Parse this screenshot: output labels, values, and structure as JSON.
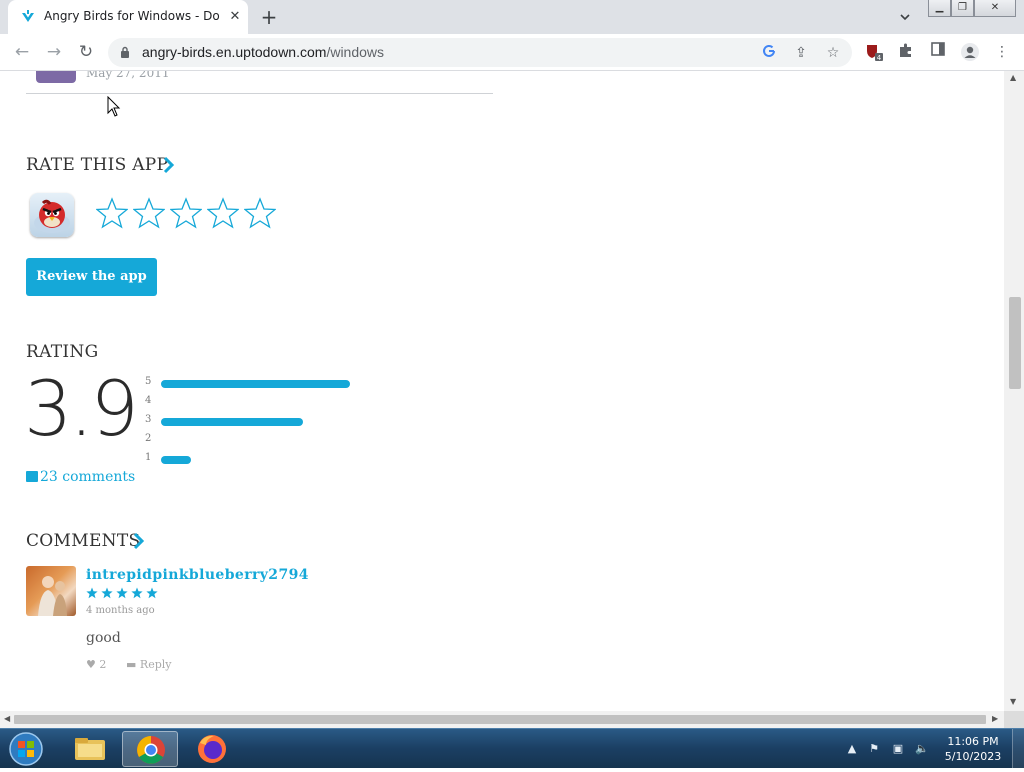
{
  "browser": {
    "tab_title": "Angry Birds for Windows - Down",
    "url_host": "angry-birds.en.uptodown.com",
    "url_path": "/windows",
    "extension_badge": "4"
  },
  "page": {
    "previous_comment_date": "May 27, 2011",
    "rate_section_title": "RATE THIS APP",
    "review_button_label": "Review the app",
    "rating_section_title": "RATING",
    "rating_score": "3.9",
    "rating_bars": [
      {
        "stars": "5",
        "fraction": 1.0
      },
      {
        "stars": "4",
        "fraction": 0.0
      },
      {
        "stars": "3",
        "fraction": 0.75
      },
      {
        "stars": "2",
        "fraction": 0.0
      },
      {
        "stars": "1",
        "fraction": 0.16
      }
    ],
    "comments_link": "23 comments",
    "comments_section_title": "COMMENTS",
    "comment": {
      "username": "intrepidpinkblueberry2794",
      "stars": 5,
      "time_ago": "4 months ago",
      "text": "good",
      "likes": "2",
      "reply_label": "Reply"
    }
  },
  "taskbar": {
    "time": "11:06 PM",
    "date": "5/10/2023"
  },
  "colors": {
    "accent": "#15a8d8",
    "taskbar": "#1b3f63"
  }
}
